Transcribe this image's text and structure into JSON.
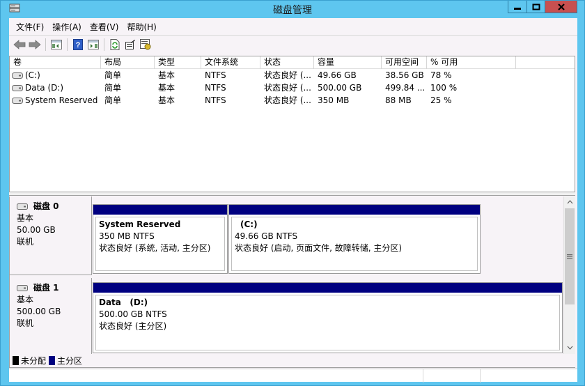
{
  "window": {
    "title": "磁盘管理",
    "controls": {
      "minimize": "minimize",
      "maximize": "maximize",
      "close": "close"
    }
  },
  "menu": [
    "文件(F)",
    "操作(A)",
    "查看(V)",
    "帮助(H)"
  ],
  "toolbar": {
    "icons": [
      "back-arrow-icon",
      "forward-arrow-icon",
      "show-hide-console-tree-icon",
      "help-icon",
      "show-hide-action-pane-icon",
      "refresh-icon",
      "properties-icon",
      "rescan-disks-icon"
    ]
  },
  "volumes": {
    "columns": [
      "卷",
      "布局",
      "类型",
      "文件系统",
      "状态",
      "容量",
      "可用空间",
      "% 可用",
      ""
    ],
    "rows": [
      {
        "volume": "(C:)",
        "layout": "简单",
        "type": "基本",
        "fs": "NTFS",
        "status": "状态良好 (...",
        "capacity": "49.66 GB",
        "free": "38.56 GB",
        "pct_free": "78 %"
      },
      {
        "volume": "Data (D:)",
        "layout": "简单",
        "type": "基本",
        "fs": "NTFS",
        "status": "状态良好 (...",
        "capacity": "500.00 GB",
        "free": "499.84 ...",
        "pct_free": "100 %"
      },
      {
        "volume": "System Reserved",
        "layout": "简单",
        "type": "基本",
        "fs": "NTFS",
        "status": "状态良好 (...",
        "capacity": "350 MB",
        "free": "88 MB",
        "pct_free": "25 %"
      }
    ]
  },
  "disks": [
    {
      "name": "磁盘 0",
      "type": "基本",
      "size": "50.00 GB",
      "state": "联机",
      "partitions": [
        {
          "title": "System Reserved",
          "size_fs": "350 MB NTFS",
          "status": "状态良好 (系统, 活动, 主分区)"
        },
        {
          "title": "(C:)",
          "size_fs": "49.66 GB NTFS",
          "status": "状态良好 (启动, 页面文件, 故障转储, 主分区)"
        }
      ]
    },
    {
      "name": "磁盘 1",
      "type": "基本",
      "size": "500.00 GB",
      "state": "联机",
      "partitions": [
        {
          "title": "Data   (D:)",
          "size_fs": "500.00 GB NTFS",
          "status": "状态良好 (主分区)"
        }
      ]
    }
  ],
  "legend": [
    {
      "label": "未分配",
      "color": "#000000"
    },
    {
      "label": "主分区",
      "color": "#000080"
    }
  ],
  "colors": {
    "titlebar": "#5ec6ef",
    "close_button": "#c75050",
    "primary_partition": "#000080",
    "unallocated": "#000000"
  }
}
